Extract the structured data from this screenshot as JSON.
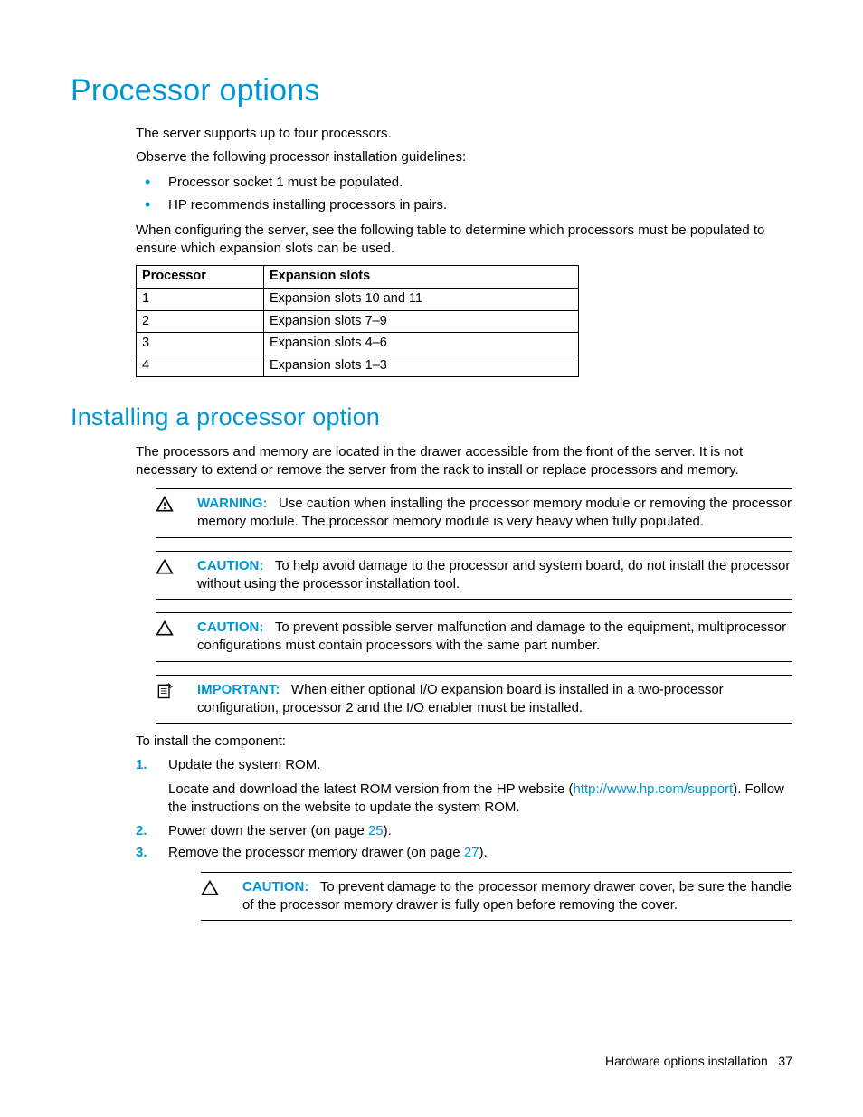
{
  "heading1": "Processor options",
  "intro1": "The server supports up to four processors.",
  "intro2": "Observe the following processor installation guidelines:",
  "bullets": [
    "Processor socket 1 must be populated.",
    "HP recommends installing processors in pairs."
  ],
  "intro3": "When configuring the server, see the following table to determine which processors must be populated to ensure which expansion slots can be used.",
  "table": {
    "headers": [
      "Processor",
      "Expansion slots"
    ],
    "rows": [
      [
        "1",
        "Expansion slots 10 and 11"
      ],
      [
        "2",
        "Expansion slots 7–9"
      ],
      [
        "3",
        "Expansion slots 4–6"
      ],
      [
        "4",
        "Expansion slots 1–3"
      ]
    ]
  },
  "heading2": "Installing a processor option",
  "para2_1": "The processors and memory are located in the drawer accessible from the front of the server. It is not necessary to extend or remove the server from the rack to install or replace processors and memory.",
  "warn_label": "WARNING:",
  "warn_text": "Use caution when installing the processor memory module or removing the processor memory module. The processor memory module is very heavy when fully populated.",
  "caution_label": "CAUTION:",
  "caution1_text": "To help avoid damage to the processor and system board, do not install the processor without using the processor installation tool.",
  "caution2_text": "To prevent possible server malfunction and damage to the equipment, multiprocessor configurations must contain processors with the same part number.",
  "important_label": "IMPORTANT:",
  "important_text": "When either optional I/O expansion board is installed in a two-processor configuration, processor 2 and the I/O enabler must be installed.",
  "install_lead": "To install the component:",
  "step1_a": "Update the system ROM.",
  "step1_b_pre": "Locate and download the latest ROM version from the HP website (",
  "step1_b_link": "http://www.hp.com/support",
  "step1_b_post": "). Follow the instructions on the website to update the system ROM.",
  "step2_pre": "Power down the server (on page ",
  "step2_link": "25",
  "step2_post": ").",
  "step3_pre": "Remove the processor memory drawer (on page ",
  "step3_link": "27",
  "step3_post": ").",
  "step3_caution": "To prevent damage to the processor memory drawer cover, be sure the handle of the processor memory drawer is fully open before removing the cover.",
  "footer_text": "Hardware options installation",
  "footer_page": "37"
}
